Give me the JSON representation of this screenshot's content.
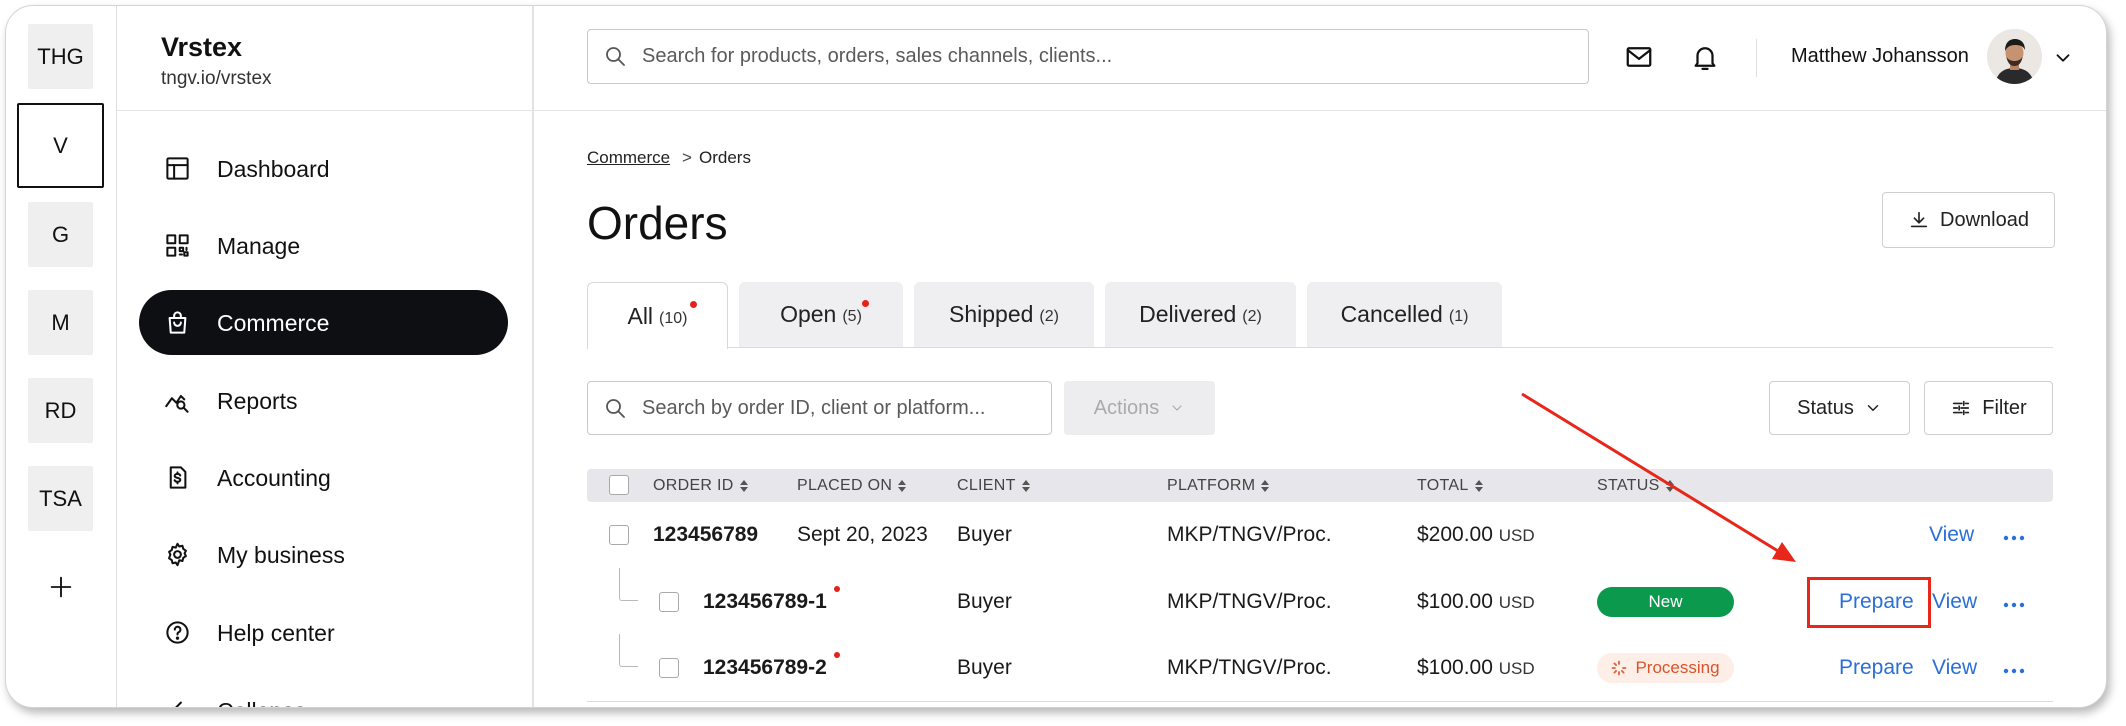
{
  "workspaces": [
    "THG",
    "V",
    "G",
    "M",
    "RD",
    "TSA"
  ],
  "selected_workspace": "V",
  "org": {
    "name": "Vrstex",
    "url": "tngv.io/vrstex"
  },
  "nav": [
    {
      "label": "Dashboard",
      "icon": "layout-icon"
    },
    {
      "label": "Manage",
      "icon": "qr-code-icon"
    },
    {
      "label": "Commerce",
      "icon": "shopping-bag-icon",
      "active": true
    },
    {
      "label": "Reports",
      "icon": "chart-search-icon"
    },
    {
      "label": "Accounting",
      "icon": "invoice-dollar-icon"
    },
    {
      "label": "My business",
      "icon": "gear-icon"
    },
    {
      "label": "Help center",
      "icon": "help-circle-icon"
    },
    {
      "label": "Collapse",
      "icon": "chevron-left-icon"
    }
  ],
  "topbar": {
    "search_placeholder": "Search for products, orders, sales channels, clients...",
    "user_name": "Matthew Johansson"
  },
  "breadcrumb": {
    "parent": "Commerce",
    "separator": ">",
    "current": "Orders"
  },
  "page": {
    "title": "Orders",
    "download_label": "Download"
  },
  "tabs": [
    {
      "label": "All",
      "count": "(10)",
      "dot": true,
      "active": true
    },
    {
      "label": "Open",
      "count": "(5)",
      "dot": true
    },
    {
      "label": "Shipped",
      "count": "(2)"
    },
    {
      "label": "Delivered",
      "count": "(2)"
    },
    {
      "label": "Cancelled",
      "count": "(1)"
    }
  ],
  "toolbar": {
    "search_placeholder": "Search by order ID, client or platform...",
    "actions_label": "Actions",
    "status_label": "Status",
    "filter_label": "Filter"
  },
  "table": {
    "columns": [
      "ORDER ID",
      "PLACED ON",
      "CLIENT",
      "PLATFORM",
      "TOTAL",
      "STATUS"
    ],
    "rows": [
      {
        "order_id": "123456789",
        "placed_on": "Sept 20, 2023",
        "client": "Buyer",
        "platform": "MKP/TNGV/Proc.",
        "total": "$200.00",
        "currency": "USD",
        "view": "View"
      },
      {
        "order_id": "123456789-1",
        "client": "Buyer",
        "platform": "MKP/TNGV/Proc.",
        "total": "$100.00",
        "currency": "USD",
        "status": "New",
        "prepare": "Prepare",
        "view": "View",
        "dot": true
      },
      {
        "order_id": "123456789-2",
        "client": "Buyer",
        "platform": "MKP/TNGV/Proc.",
        "total": "$100.00",
        "currency": "USD",
        "status": "Processing",
        "prepare": "Prepare",
        "view": "View",
        "dot": true
      }
    ]
  },
  "colors": {
    "nav_active_bg": "#0e0f12",
    "link": "#2a6fd6",
    "status_new_bg": "#0b9a4d",
    "status_processing_bg": "#fdeee8",
    "status_processing_text": "#d8542a",
    "notification_dot": "#e3221b",
    "annotation": "#e8261a"
  }
}
